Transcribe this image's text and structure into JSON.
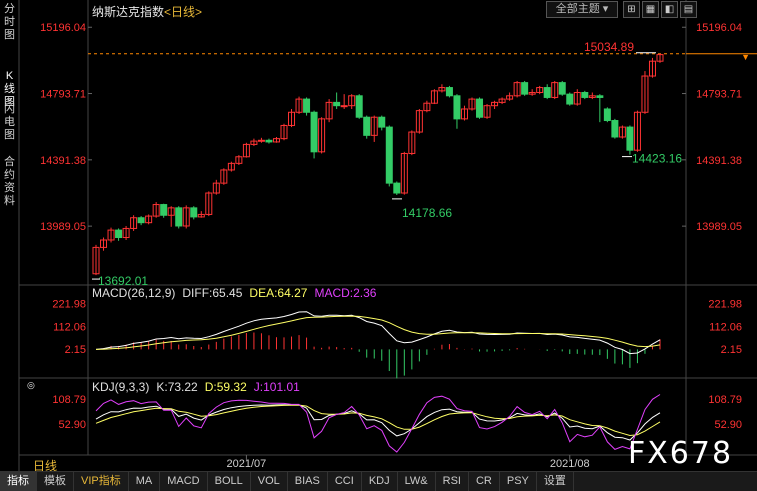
{
  "sidebar": {
    "tabs": [
      {
        "label": "分时图",
        "name": "tab-time-sharing"
      },
      {
        "label": "K线图",
        "name": "tab-kline",
        "active": true
      },
      {
        "label": "闪电图",
        "name": "tab-flash"
      },
      {
        "label": "合约资料",
        "name": "tab-contract-info"
      }
    ]
  },
  "header": {
    "title": "纳斯达克指数",
    "period": "<日线>",
    "theme_button": "全部主题",
    "icons": [
      "grid-icon",
      "calendar-icon",
      "chart-style-icon",
      "settings-icon"
    ]
  },
  "colors": {
    "up": "#ff3333",
    "down": "#33cc66",
    "axis_label": "#ff3333",
    "current_price_line": "#ff8800",
    "diff": "#ffffff",
    "dea": "#ffff66",
    "macd_k": "#e040fb",
    "watermark": "#ffffff"
  },
  "price_axis": {
    "labels": [
      "15196.04",
      "14793.71",
      "14391.38",
      "13989.05"
    ]
  },
  "annotations": {
    "high": "15034.89",
    "low_pivot": "14178.66",
    "recent_low": "14423.16",
    "period_low": "13692.01"
  },
  "macd": {
    "title": "MACD(26,12,9)",
    "diff": "DIFF:65.45",
    "dea": "DEA:64.27",
    "macd": "MACD:2.36",
    "axis": [
      "221.98",
      "112.06",
      "2.15"
    ]
  },
  "kdj": {
    "title": "KDJ(9,3,3)",
    "k": "K:73.22",
    "d": "D:59.32",
    "j": "J:101.01",
    "axis": [
      "108.79",
      "52.90"
    ]
  },
  "x_axis": {
    "labels": [
      "2021/07",
      "2021/08"
    ]
  },
  "period_label": "日线",
  "bottom_tabs": [
    "指标",
    "模板",
    "VIP指标",
    "MA",
    "MACD",
    "BOLL",
    "VOL",
    "BIAS",
    "CCI",
    "KDJ",
    "LW&",
    "RSI",
    "CR",
    "PSY",
    "设置"
  ],
  "watermark": "FX678",
  "chart_data": {
    "type": "candlestick",
    "ylim": [
      13650,
      15240
    ],
    "candles": [
      {
        "o": 13700,
        "c": 13860,
        "h": 13875,
        "l": 13692
      },
      {
        "o": 13860,
        "c": 13905,
        "h": 13920,
        "l": 13840
      },
      {
        "o": 13905,
        "c": 13965,
        "h": 13980,
        "l": 13890
      },
      {
        "o": 13965,
        "c": 13920,
        "h": 13975,
        "l": 13900
      },
      {
        "o": 13920,
        "c": 13975,
        "h": 13990,
        "l": 13905
      },
      {
        "o": 13975,
        "c": 14040,
        "h": 14055,
        "l": 13960
      },
      {
        "o": 14040,
        "c": 14010,
        "h": 14050,
        "l": 13995
      },
      {
        "o": 14010,
        "c": 14050,
        "h": 14060,
        "l": 14000
      },
      {
        "o": 14050,
        "c": 14120,
        "h": 14135,
        "l": 14040
      },
      {
        "o": 14120,
        "c": 14055,
        "h": 14125,
        "l": 14040
      },
      {
        "o": 14055,
        "c": 14100,
        "h": 14110,
        "l": 13985
      },
      {
        "o": 14100,
        "c": 13990,
        "h": 14110,
        "l": 13975
      },
      {
        "o": 13990,
        "c": 14100,
        "h": 14115,
        "l": 13975
      },
      {
        "o": 14100,
        "c": 14045,
        "h": 14110,
        "l": 14030
      },
      {
        "o": 14045,
        "c": 14060,
        "h": 14080,
        "l": 14040
      },
      {
        "o": 14060,
        "c": 14190,
        "h": 14200,
        "l": 14050
      },
      {
        "o": 14190,
        "c": 14250,
        "h": 14270,
        "l": 14180
      },
      {
        "o": 14250,
        "c": 14330,
        "h": 14340,
        "l": 14240
      },
      {
        "o": 14330,
        "c": 14370,
        "h": 14380,
        "l": 14320
      },
      {
        "o": 14370,
        "c": 14410,
        "h": 14420,
        "l": 14360
      },
      {
        "o": 14410,
        "c": 14485,
        "h": 14495,
        "l": 14405
      },
      {
        "o": 14485,
        "c": 14505,
        "h": 14520,
        "l": 14475
      },
      {
        "o": 14505,
        "c": 14510,
        "h": 14525,
        "l": 14495
      },
      {
        "o": 14510,
        "c": 14500,
        "h": 14520,
        "l": 14490
      },
      {
        "o": 14500,
        "c": 14520,
        "h": 14530,
        "l": 14495
      },
      {
        "o": 14520,
        "c": 14600,
        "h": 14610,
        "l": 14510
      },
      {
        "o": 14600,
        "c": 14680,
        "h": 14700,
        "l": 14590
      },
      {
        "o": 14680,
        "c": 14760,
        "h": 14775,
        "l": 14670
      },
      {
        "o": 14760,
        "c": 14680,
        "h": 14770,
        "l": 14660
      },
      {
        "o": 14680,
        "c": 14440,
        "h": 14690,
        "l": 14400
      },
      {
        "o": 14440,
        "c": 14640,
        "h": 14650,
        "l": 14430
      },
      {
        "o": 14640,
        "c": 14740,
        "h": 14760,
        "l": 14620
      },
      {
        "o": 14740,
        "c": 14720,
        "h": 14800,
        "l": 14700
      },
      {
        "o": 14720,
        "c": 14720,
        "h": 14790,
        "l": 14700
      },
      {
        "o": 14720,
        "c": 14780,
        "h": 14790,
        "l": 14700
      },
      {
        "o": 14780,
        "c": 14650,
        "h": 14790,
        "l": 14640
      },
      {
        "o": 14650,
        "c": 14540,
        "h": 14660,
        "l": 14520
      },
      {
        "o": 14540,
        "c": 14650,
        "h": 14660,
        "l": 14500
      },
      {
        "o": 14650,
        "c": 14590,
        "h": 14660,
        "l": 14570
      },
      {
        "o": 14590,
        "c": 14250,
        "h": 14600,
        "l": 14230
      },
      {
        "o": 14250,
        "c": 14190,
        "h": 14260,
        "l": 14178
      },
      {
        "o": 14190,
        "c": 14430,
        "h": 14440,
        "l": 14180
      },
      {
        "o": 14430,
        "c": 14560,
        "h": 14570,
        "l": 14420
      },
      {
        "o": 14560,
        "c": 14690,
        "h": 14700,
        "l": 14550
      },
      {
        "o": 14690,
        "c": 14735,
        "h": 14750,
        "l": 14680
      },
      {
        "o": 14735,
        "c": 14810,
        "h": 14820,
        "l": 14730
      },
      {
        "o": 14810,
        "c": 14830,
        "h": 14850,
        "l": 14800
      },
      {
        "o": 14830,
        "c": 14780,
        "h": 14840,
        "l": 14770
      },
      {
        "o": 14780,
        "c": 14640,
        "h": 14790,
        "l": 14580
      },
      {
        "o": 14640,
        "c": 14700,
        "h": 14720,
        "l": 14630
      },
      {
        "o": 14700,
        "c": 14760,
        "h": 14770,
        "l": 14690
      },
      {
        "o": 14760,
        "c": 14650,
        "h": 14770,
        "l": 14640
      },
      {
        "o": 14650,
        "c": 14720,
        "h": 14730,
        "l": 14640
      },
      {
        "o": 14720,
        "c": 14740,
        "h": 14750,
        "l": 14700
      },
      {
        "o": 14740,
        "c": 14760,
        "h": 14770,
        "l": 14730
      },
      {
        "o": 14760,
        "c": 14780,
        "h": 14800,
        "l": 14750
      },
      {
        "o": 14780,
        "c": 14860,
        "h": 14870,
        "l": 14770
      },
      {
        "o": 14860,
        "c": 14790,
        "h": 14870,
        "l": 14780
      },
      {
        "o": 14790,
        "c": 14800,
        "h": 14820,
        "l": 14780
      },
      {
        "o": 14800,
        "c": 14830,
        "h": 14840,
        "l": 14790
      },
      {
        "o": 14830,
        "c": 14770,
        "h": 14850,
        "l": 14760
      },
      {
        "o": 14770,
        "c": 14860,
        "h": 14870,
        "l": 14760
      },
      {
        "o": 14860,
        "c": 14790,
        "h": 14870,
        "l": 14780
      },
      {
        "o": 14790,
        "c": 14730,
        "h": 14800,
        "l": 14720
      },
      {
        "o": 14730,
        "c": 14800,
        "h": 14820,
        "l": 14720
      },
      {
        "o": 14800,
        "c": 14770,
        "h": 14810,
        "l": 14760
      },
      {
        "o": 14770,
        "c": 14780,
        "h": 14800,
        "l": 14760
      },
      {
        "o": 14780,
        "c": 14770,
        "h": 14790,
        "l": 14620
      },
      {
        "o": 14700,
        "c": 14630,
        "h": 14710,
        "l": 14620
      },
      {
        "o": 14630,
        "c": 14530,
        "h": 14640,
        "l": 14520
      },
      {
        "o": 14530,
        "c": 14590,
        "h": 14600,
        "l": 14520
      },
      {
        "o": 14590,
        "c": 14450,
        "h": 14600,
        "l": 14423
      },
      {
        "o": 14450,
        "c": 14680,
        "h": 14690,
        "l": 14440
      },
      {
        "o": 14680,
        "c": 14900,
        "h": 14930,
        "l": 14670
      },
      {
        "o": 14900,
        "c": 14990,
        "h": 15010,
        "l": 14890
      },
      {
        "o": 14990,
        "c": 15030,
        "h": 15034.89,
        "l": 14980
      }
    ],
    "macd": {
      "diff": 65.45,
      "dea": 64.27,
      "macd": 2.36,
      "ylim": [
        -110,
        240
      ]
    },
    "kdj": {
      "k": 73.22,
      "d": 59.32,
      "j": 101.01,
      "ylim": [
        -10,
        125
      ]
    }
  }
}
